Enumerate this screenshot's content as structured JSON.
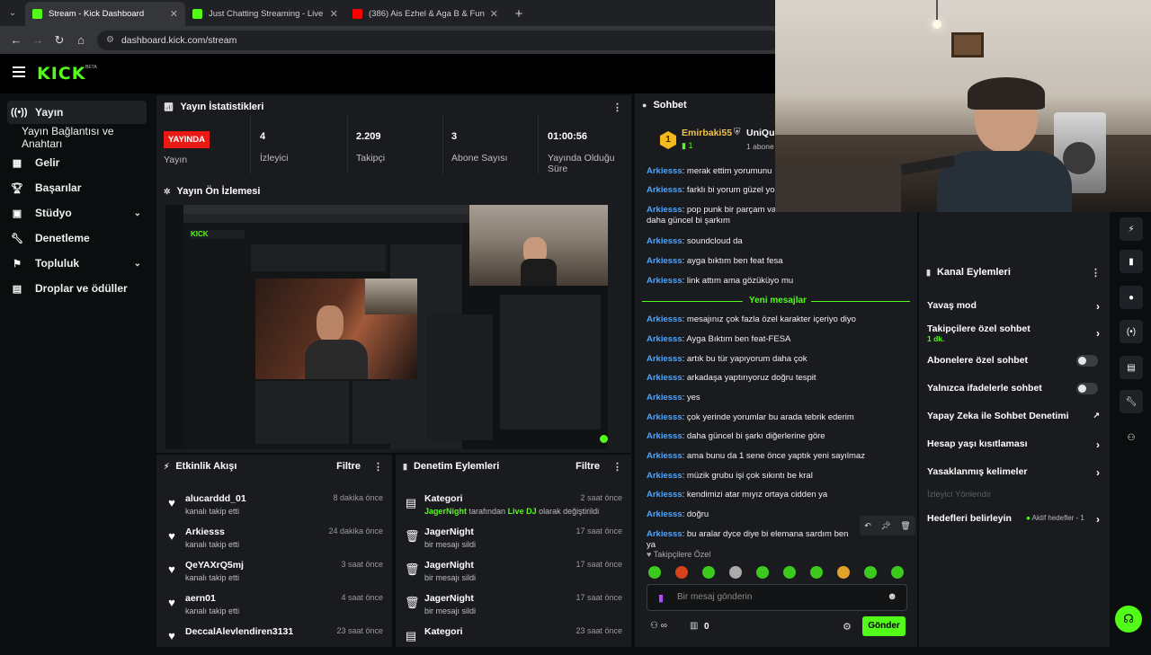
{
  "browser": {
    "tabs": [
      {
        "title": "Stream - Kick Dashboard",
        "active": true,
        "icon": "kick-icon"
      },
      {
        "title": "Just Chatting Streaming - Live",
        "active": false,
        "icon": "kick-icon"
      },
      {
        "title": "(386) Ais Ezhel & Aga B & Funk",
        "active": false,
        "icon": "youtube-icon"
      }
    ],
    "url": "dashboard.kick.com/stream"
  },
  "app": {
    "logo": "KICK",
    "beta": "BETA"
  },
  "sidebar": {
    "items": [
      {
        "label": "Yayın",
        "icon": "broadcast-icon",
        "active": true
      },
      {
        "label": "Yayın Bağlantısı ve Anahtarı",
        "sub": true
      },
      {
        "label": "Gelir",
        "icon": "chart-icon"
      },
      {
        "label": "Başarılar",
        "icon": "trophy-icon"
      },
      {
        "label": "Stüdyo",
        "icon": "studio-icon",
        "chevron": true
      },
      {
        "label": "Denetleme",
        "icon": "wrench-icon"
      },
      {
        "label": "Topluluk",
        "icon": "community-icon",
        "chevron": true
      },
      {
        "label": "Droplar ve ödüller",
        "icon": "drops-icon"
      }
    ]
  },
  "stats": {
    "title": "Yayın İstatistikleri",
    "badge": "YAYINDA",
    "status_label": "Yayın",
    "items": [
      {
        "value": "4",
        "label": "İzleyici"
      },
      {
        "value": "2.209",
        "label": "Takipçi"
      },
      {
        "value": "3",
        "label": "Abone Sayısı"
      },
      {
        "value": "01:00:56",
        "label": "Yayında Olduğu Süre"
      }
    ]
  },
  "preview": {
    "title": "Yayın Ön İzlemesi"
  },
  "activity": {
    "title": "Etkinlik Akışı",
    "filter": "Filtre",
    "rows": [
      {
        "name": "alucarddd_01",
        "desc": "kanalı takip etti",
        "time": "8 dakika önce"
      },
      {
        "name": "Arkiesss",
        "desc": "kanalı takip etti",
        "time": "24 dakika önce"
      },
      {
        "name": "QeYAXrQ5mj",
        "desc": "kanalı takip etti",
        "time": "3 saat önce"
      },
      {
        "name": "aern01",
        "desc": "kanalı takip etti",
        "time": "4 saat önce"
      },
      {
        "name": "DeccalAlevlendiren3131",
        "desc": "",
        "time": "23 saat önce"
      }
    ]
  },
  "moderation": {
    "title": "Denetim Eylemleri",
    "filter": "Filtre",
    "rows": [
      {
        "name": "Kategori",
        "desc_pre": "JagerNight",
        "desc_mid": " tarafından ",
        "desc_hl": "Live DJ",
        "desc_post": " olarak değiştirildi",
        "time": "2 saat önce",
        "icon": "category-icon"
      },
      {
        "name": "JagerNight",
        "desc": "bir mesajı sildi",
        "time": "17 saat önce",
        "icon": "trash-icon"
      },
      {
        "name": "JagerNight",
        "desc": "bir mesajı sildi",
        "time": "17 saat önce",
        "icon": "trash-icon"
      },
      {
        "name": "JagerNight",
        "desc": "bir mesajı sildi",
        "time": "17 saat önce",
        "icon": "trash-icon"
      },
      {
        "name": "Kategori",
        "desc": "",
        "time": "23 saat önce",
        "icon": "category-icon"
      }
    ]
  },
  "chat": {
    "title": "Sohbet",
    "top_user": "Emirbaki55",
    "top_user2": "UniQue",
    "top_sub": "1 abone",
    "rank": "1",
    "messages_before": [
      {
        "user": "Arkiesss",
        "text": ": merak ettim yorumunu"
      },
      {
        "user": "Arkiesss",
        "text": ": farklı bi yorum güzel yorum"
      },
      {
        "user": "Arkiesss",
        "text": ": pop punk bir parçam var son olarak ona bakabilirsiniz mu daha güncel bi şarkım"
      },
      {
        "user": "Arkiesss",
        "text": ": soundcloud da"
      },
      {
        "user": "Arkiesss",
        "text": ": ayga bıktım ben feat fesa"
      },
      {
        "user": "Arkiesss",
        "text": ": link attım ama gözüküyo mu"
      }
    ],
    "new_label": "Yeni mesajlar",
    "messages_after": [
      {
        "user": "Arkiesss",
        "text": ": mesajınız çok fazla özel karakter içeriyo diyo"
      },
      {
        "user": "Arkiesss",
        "text": ": Ayga Bıktım ben feat-FESA"
      },
      {
        "user": "Arkiesss",
        "text": ": artık bu tür yapıyorum daha çok"
      },
      {
        "user": "Arkiesss",
        "text": ": arkadaşa yaptırıyoruz doğru tespit"
      },
      {
        "user": "Arkiesss",
        "text": ": yes"
      },
      {
        "user": "Arkiesss",
        "text": ": çok yerinde yorumlar bu arada tebrik ederim"
      },
      {
        "user": "Arkiesss",
        "text": ": daha güncel bi şarkı diğerlerine göre"
      },
      {
        "user": "Arkiesss",
        "text": ": ama bunu da 1 sene önce yaptık yeni sayılmaz"
      },
      {
        "user": "Arkiesss",
        "text": ": müzik grubu işi çok sıkıntı be kral"
      },
      {
        "user": "Arkiesss",
        "text": ": kendimizi atar mıyız ortaya cidden ya"
      },
      {
        "user": "Arkiesss",
        "text": ": doğru"
      },
      {
        "user": "Arkiesss",
        "text": ": bu aralar dyce diye bi elemana sardım ben ya"
      }
    ],
    "followers_only": "Takipçilere Özel",
    "input_placeholder": "Bir mesaj gönderin",
    "points": "0",
    "send": "Gönder"
  },
  "channel_actions": {
    "title": "Kanal Eylemleri",
    "rows": [
      {
        "label": "Yavaş mod",
        "kind": "arrow"
      },
      {
        "label": "Takipçilere özel sohbet",
        "sub": "1 dk.",
        "kind": "arrow"
      },
      {
        "label": "Abonelere özel sohbet",
        "kind": "toggle"
      },
      {
        "label": "Yalnızca ifadelerle sohbet",
        "kind": "toggle"
      },
      {
        "label": "Yapay Zeka ile Sohbet Denetimi",
        "kind": "external"
      },
      {
        "label": "Hesap yaşı kısıtlaması",
        "kind": "arrow"
      },
      {
        "label": "Yasaklanmış kelimeler",
        "kind": "arrow"
      },
      {
        "label": "İzleyici Yönlendir",
        "kind": "disabled"
      },
      {
        "label": "Hedefleri belirleyin",
        "status": "Aktif hedefler - 1",
        "kind": "arrow"
      }
    ]
  },
  "colors": {
    "brand": "#53fc18",
    "live": "#e91916",
    "username": "#4da6ff"
  }
}
